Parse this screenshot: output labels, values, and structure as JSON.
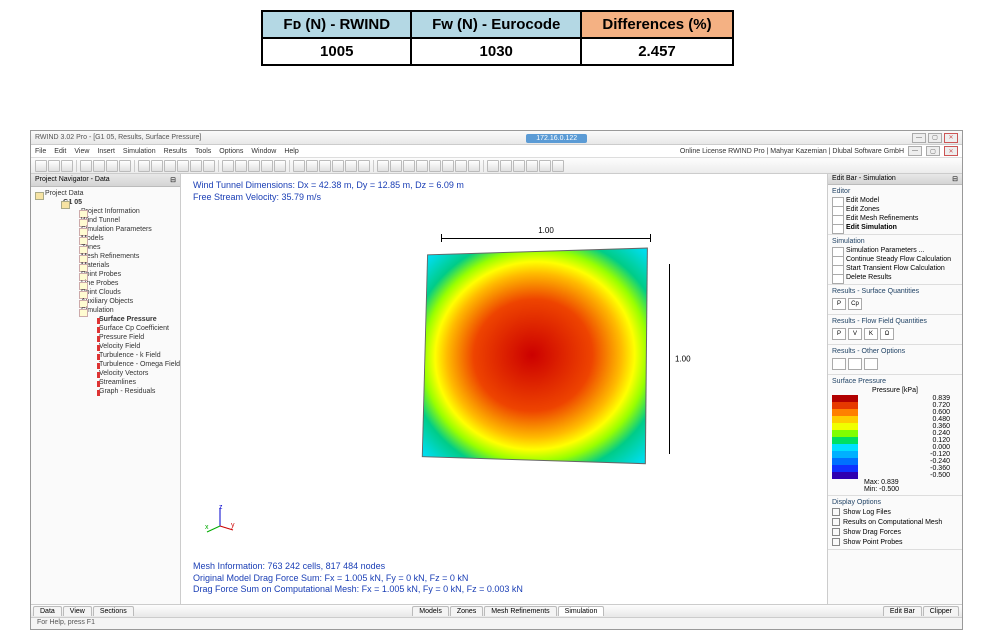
{
  "comparison_table": {
    "headers": [
      "Fᴅ (N) - RWIND",
      "Fᴡ (N) - Eurocode",
      "Differences (%)"
    ],
    "values": [
      "1005",
      "1030",
      "2.457"
    ]
  },
  "window": {
    "title_left": "RWIND 3.02 Pro - [G1 05, Results, Surface Pressure]",
    "ip": "172.16.0.122",
    "license": "Online License RWIND Pro | Mahyar Kazemian | Dlubal Software GmbH",
    "win_min": "—",
    "win_max": "▢",
    "win_close": "✕",
    "sub_close": "✕",
    "sub_max": "▢",
    "sub_min": "—"
  },
  "menubar": [
    "File",
    "Edit",
    "View",
    "Insert",
    "Simulation",
    "Results",
    "Tools",
    "Options",
    "Window",
    "Help"
  ],
  "nav": {
    "header": "Project Navigator - Data",
    "root": "Project Data",
    "project": "G1 05",
    "items": [
      "Project Information",
      "Wind Tunnel",
      "Simulation Parameters",
      "Models",
      "Zones",
      "Mesh Refinements",
      "Materials",
      "Point Probes",
      "Line Probes",
      "Point Clouds",
      "Auxiliary Objects",
      "Simulation"
    ],
    "sim_children": [
      "Surface Pressure",
      "Surface Cp Coefficient",
      "Pressure Field",
      "Velocity Field",
      "Turbulence - k Field",
      "Turbulence - Omega Field",
      "Velocity Vectors",
      "Streamlines",
      "Graph - Residuals"
    ]
  },
  "viewport": {
    "line1": "Wind Tunnel Dimensions: Dx = 42.38 m, Dy = 12.85 m, Dz = 6.09 m",
    "line2": "Free Stream Velocity: 35.79 m/s",
    "dim_w": "1.00",
    "dim_h": "1.00",
    "bottom1": "Mesh Information: 763 242 cells, 817 484 nodes",
    "bottom2": "Original Model Drag Force Sum: Fx = 1.005 kN, Fy = 0 kN, Fz = 0 kN",
    "bottom3": "Drag Force Sum on Computational Mesh: Fx = 1.005 kN, Fy = 0 kN, Fz = 0.003 kN"
  },
  "rightbar": {
    "header": "Edit Bar - Simulation",
    "editor_title": "Editor",
    "editor": [
      "Edit Model",
      "Edit Zones",
      "Edit Mesh Refinements",
      "Edit Simulation"
    ],
    "sim_title": "Simulation",
    "simulation": [
      "Simulation Parameters ...",
      "Continue Steady Flow Calculation",
      "Start Transient Flow Calculation",
      "Delete Results"
    ],
    "results_surf_title": "Results - Surface Quantities",
    "results_flow_title": "Results - Flow Field Quantities",
    "results_other_title": "Results - Other Options",
    "surf_btns": [
      "P",
      "Cp"
    ],
    "flow_btns": [
      "P",
      "V",
      "K",
      "Ω"
    ],
    "legend_header": "Surface Pressure",
    "legend_unit": "Pressure [kPa]",
    "legend": [
      {
        "c": "#b10000",
        "v": "0.839"
      },
      {
        "c": "#e63900",
        "v": "0.720"
      },
      {
        "c": "#ff8000",
        "v": "0.600"
      },
      {
        "c": "#ffcc00",
        "v": "0.480"
      },
      {
        "c": "#f0ff00",
        "v": "0.360"
      },
      {
        "c": "#80ff00",
        "v": "0.240"
      },
      {
        "c": "#00e060",
        "v": "0.120"
      },
      {
        "c": "#00e0ff",
        "v": "0.000"
      },
      {
        "c": "#00b0ff",
        "v": "-0.120"
      },
      {
        "c": "#0070ff",
        "v": "-0.240"
      },
      {
        "c": "#1030ff",
        "v": "-0.360"
      },
      {
        "c": "#3000b0",
        "v": "-0.500"
      }
    ],
    "legend_max": "Max: 0.839",
    "legend_min": "Min: -0.500",
    "display_title": "Display Options",
    "display": [
      "Show Log Files",
      "Results on Computational Mesh",
      "Show Drag Forces",
      "Show Point Probes"
    ]
  },
  "bottom_tabs": {
    "left": [
      "Data",
      "View",
      "Sections"
    ],
    "center": [
      "Models",
      "Zones",
      "Mesh Refinements",
      "Simulation"
    ],
    "right": [
      "Edit Bar",
      "Clipper"
    ]
  },
  "statusbar": "For Help, press F1"
}
